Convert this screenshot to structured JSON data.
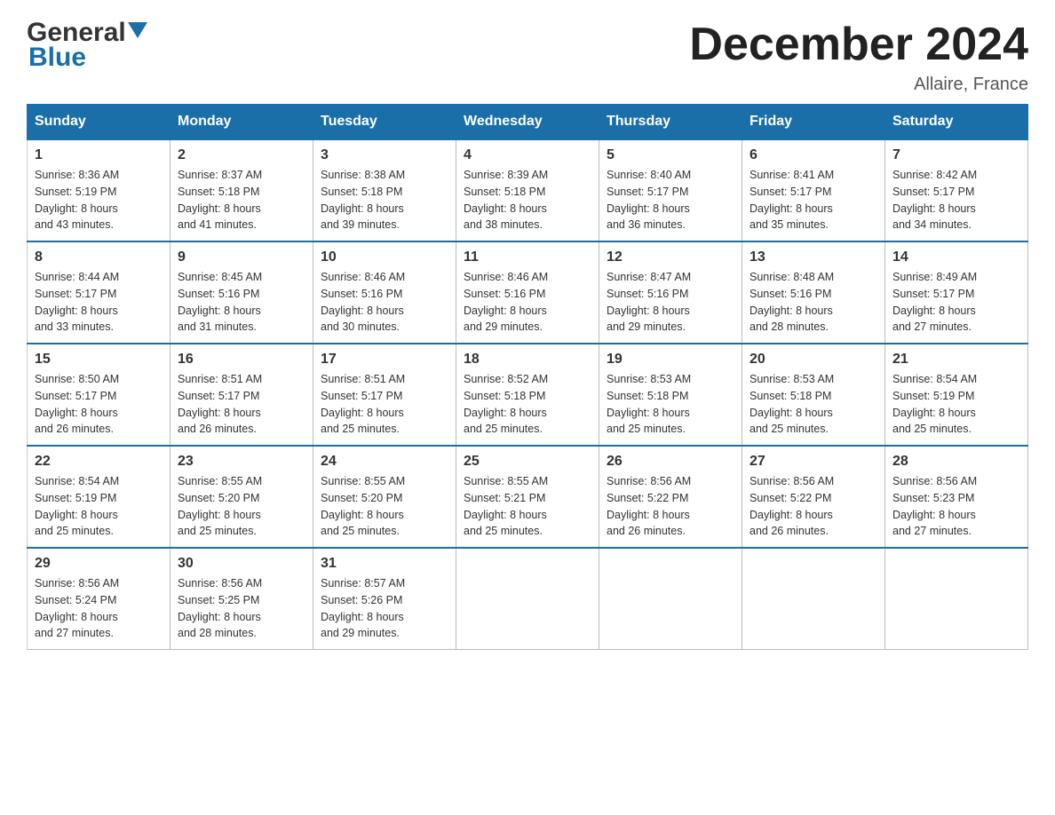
{
  "header": {
    "logo_general": "General",
    "logo_blue": "Blue",
    "month_title": "December 2024",
    "location": "Allaire, France"
  },
  "days_of_week": [
    "Sunday",
    "Monday",
    "Tuesday",
    "Wednesday",
    "Thursday",
    "Friday",
    "Saturday"
  ],
  "weeks": [
    [
      {
        "day": "1",
        "sunrise": "8:36 AM",
        "sunset": "5:19 PM",
        "daylight": "8 hours and 43 minutes."
      },
      {
        "day": "2",
        "sunrise": "8:37 AM",
        "sunset": "5:18 PM",
        "daylight": "8 hours and 41 minutes."
      },
      {
        "day": "3",
        "sunrise": "8:38 AM",
        "sunset": "5:18 PM",
        "daylight": "8 hours and 39 minutes."
      },
      {
        "day": "4",
        "sunrise": "8:39 AM",
        "sunset": "5:18 PM",
        "daylight": "8 hours and 38 minutes."
      },
      {
        "day": "5",
        "sunrise": "8:40 AM",
        "sunset": "5:17 PM",
        "daylight": "8 hours and 36 minutes."
      },
      {
        "day": "6",
        "sunrise": "8:41 AM",
        "sunset": "5:17 PM",
        "daylight": "8 hours and 35 minutes."
      },
      {
        "day": "7",
        "sunrise": "8:42 AM",
        "sunset": "5:17 PM",
        "daylight": "8 hours and 34 minutes."
      }
    ],
    [
      {
        "day": "8",
        "sunrise": "8:44 AM",
        "sunset": "5:17 PM",
        "daylight": "8 hours and 33 minutes."
      },
      {
        "day": "9",
        "sunrise": "8:45 AM",
        "sunset": "5:16 PM",
        "daylight": "8 hours and 31 minutes."
      },
      {
        "day": "10",
        "sunrise": "8:46 AM",
        "sunset": "5:16 PM",
        "daylight": "8 hours and 30 minutes."
      },
      {
        "day": "11",
        "sunrise": "8:46 AM",
        "sunset": "5:16 PM",
        "daylight": "8 hours and 29 minutes."
      },
      {
        "day": "12",
        "sunrise": "8:47 AM",
        "sunset": "5:16 PM",
        "daylight": "8 hours and 29 minutes."
      },
      {
        "day": "13",
        "sunrise": "8:48 AM",
        "sunset": "5:16 PM",
        "daylight": "8 hours and 28 minutes."
      },
      {
        "day": "14",
        "sunrise": "8:49 AM",
        "sunset": "5:17 PM",
        "daylight": "8 hours and 27 minutes."
      }
    ],
    [
      {
        "day": "15",
        "sunrise": "8:50 AM",
        "sunset": "5:17 PM",
        "daylight": "8 hours and 26 minutes."
      },
      {
        "day": "16",
        "sunrise": "8:51 AM",
        "sunset": "5:17 PM",
        "daylight": "8 hours and 26 minutes."
      },
      {
        "day": "17",
        "sunrise": "8:51 AM",
        "sunset": "5:17 PM",
        "daylight": "8 hours and 25 minutes."
      },
      {
        "day": "18",
        "sunrise": "8:52 AM",
        "sunset": "5:18 PM",
        "daylight": "8 hours and 25 minutes."
      },
      {
        "day": "19",
        "sunrise": "8:53 AM",
        "sunset": "5:18 PM",
        "daylight": "8 hours and 25 minutes."
      },
      {
        "day": "20",
        "sunrise": "8:53 AM",
        "sunset": "5:18 PM",
        "daylight": "8 hours and 25 minutes."
      },
      {
        "day": "21",
        "sunrise": "8:54 AM",
        "sunset": "5:19 PM",
        "daylight": "8 hours and 25 minutes."
      }
    ],
    [
      {
        "day": "22",
        "sunrise": "8:54 AM",
        "sunset": "5:19 PM",
        "daylight": "8 hours and 25 minutes."
      },
      {
        "day": "23",
        "sunrise": "8:55 AM",
        "sunset": "5:20 PM",
        "daylight": "8 hours and 25 minutes."
      },
      {
        "day": "24",
        "sunrise": "8:55 AM",
        "sunset": "5:20 PM",
        "daylight": "8 hours and 25 minutes."
      },
      {
        "day": "25",
        "sunrise": "8:55 AM",
        "sunset": "5:21 PM",
        "daylight": "8 hours and 25 minutes."
      },
      {
        "day": "26",
        "sunrise": "8:56 AM",
        "sunset": "5:22 PM",
        "daylight": "8 hours and 26 minutes."
      },
      {
        "day": "27",
        "sunrise": "8:56 AM",
        "sunset": "5:22 PM",
        "daylight": "8 hours and 26 minutes."
      },
      {
        "day": "28",
        "sunrise": "8:56 AM",
        "sunset": "5:23 PM",
        "daylight": "8 hours and 27 minutes."
      }
    ],
    [
      {
        "day": "29",
        "sunrise": "8:56 AM",
        "sunset": "5:24 PM",
        "daylight": "8 hours and 27 minutes."
      },
      {
        "day": "30",
        "sunrise": "8:56 AM",
        "sunset": "5:25 PM",
        "daylight": "8 hours and 28 minutes."
      },
      {
        "day": "31",
        "sunrise": "8:57 AM",
        "sunset": "5:26 PM",
        "daylight": "8 hours and 29 minutes."
      },
      null,
      null,
      null,
      null
    ]
  ],
  "labels": {
    "sunrise": "Sunrise:",
    "sunset": "Sunset:",
    "daylight": "Daylight:"
  }
}
